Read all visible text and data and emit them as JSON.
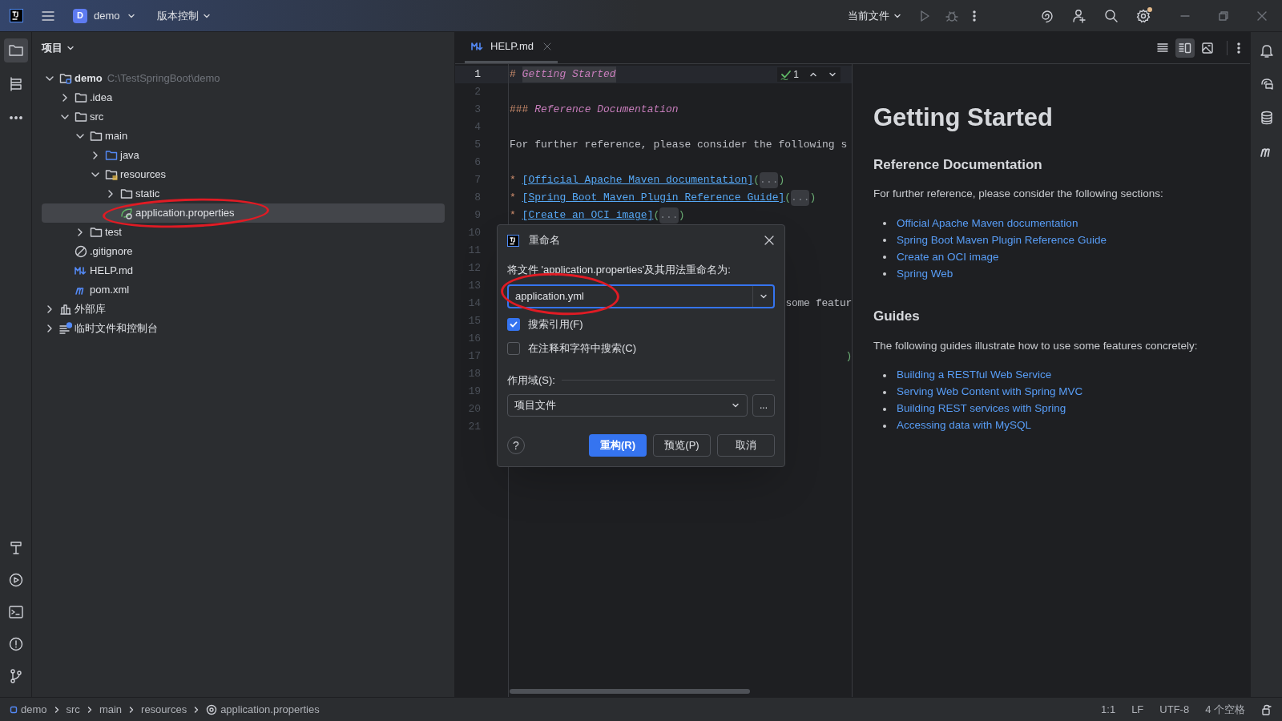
{
  "title_bar": {
    "app_initial": "D",
    "project": "demo",
    "vcs": "版本控制",
    "run_config": "当前文件"
  },
  "tool_windows": [
    {
      "kind": "project",
      "selected": true
    },
    {
      "kind": "structure",
      "selected": false
    },
    {
      "kind": "more",
      "selected": false
    }
  ],
  "project_panel": {
    "title": "项目",
    "tree": [
      {
        "label": "demo",
        "path": "C:\\TestSpringBoot\\demo",
        "kind": "module",
        "expanded": true,
        "selected": false,
        "children": [
          {
            "label": ".idea",
            "kind": "folder",
            "expanded": false,
            "selected": false
          },
          {
            "label": "src",
            "kind": "folder",
            "expanded": true,
            "selected": false,
            "children": [
              {
                "label": "main",
                "kind": "folder",
                "expanded": true,
                "selected": false,
                "children": [
                  {
                    "label": "java",
                    "kind": "source",
                    "expanded": false,
                    "selected": false
                  },
                  {
                    "label": "resources",
                    "kind": "resources",
                    "expanded": true,
                    "selected": false,
                    "children": [
                      {
                        "label": "static",
                        "kind": "folder",
                        "expanded": false,
                        "selected": false
                      },
                      {
                        "label": "application.properties",
                        "kind": "spring",
                        "selected": true,
                        "circled": true
                      }
                    ]
                  }
                ]
              },
              {
                "label": "test",
                "kind": "folder",
                "expanded": false,
                "selected": false
              }
            ]
          },
          {
            "label": ".gitignore",
            "kind": "ignore",
            "selected": false
          },
          {
            "label": "HELP.md",
            "kind": "markdown",
            "selected": false
          },
          {
            "label": "pom.xml",
            "kind": "maven",
            "selected": false
          }
        ]
      },
      {
        "label": "外部库",
        "kind": "library",
        "expanded": false,
        "selected": false
      },
      {
        "label": "临时文件和控制台",
        "kind": "scratch",
        "expanded": false,
        "selected": false
      }
    ]
  },
  "editor": {
    "tabs": [
      {
        "label": "HELP.md",
        "selected": true
      }
    ],
    "inspection_count": "1",
    "view_modes": [
      {
        "kind": "editor",
        "selected": false
      },
      {
        "kind": "split",
        "selected": true
      },
      {
        "kind": "preview",
        "selected": false
      }
    ],
    "lines": [
      {
        "number": "1",
        "current": true,
        "segments": [
          {
            "kind": "mark",
            "text": "# "
          },
          {
            "kind": "heading",
            "text": "Getting Started"
          }
        ]
      },
      {
        "number": "2",
        "current": false
      },
      {
        "number": "3",
        "current": false,
        "segments": [
          {
            "kind": "mark",
            "text": "### "
          },
          {
            "kind": "heading",
            "text": "Reference Documentation"
          }
        ]
      },
      {
        "number": "4",
        "current": false
      },
      {
        "number": "5",
        "current": false,
        "segments": [
          {
            "kind": "plain",
            "text": "For further reference, please consider the following s"
          }
        ]
      },
      {
        "number": "6",
        "current": false
      },
      {
        "number": "7",
        "current": false,
        "segments": [
          {
            "kind": "bullet",
            "text": "* "
          },
          {
            "kind": "link",
            "text": "[Official Apache Maven documentation]"
          },
          {
            "kind": "paren",
            "text": "("
          },
          {
            "kind": "fold",
            "text": "..."
          },
          {
            "kind": "paren",
            "text": ")"
          }
        ]
      },
      {
        "number": "8",
        "current": false,
        "segments": [
          {
            "kind": "bullet",
            "text": "* "
          },
          {
            "kind": "link",
            "text": "[Spring Boot Maven Plugin Reference Guide]"
          },
          {
            "kind": "paren",
            "text": "("
          },
          {
            "kind": "fold",
            "text": "..."
          },
          {
            "kind": "paren",
            "text": ")"
          }
        ]
      },
      {
        "number": "9",
        "current": false,
        "segments": [
          {
            "kind": "bullet",
            "text": "* "
          },
          {
            "kind": "link",
            "text": "[Create an OCI image]"
          },
          {
            "kind": "paren",
            "text": "("
          },
          {
            "kind": "fold",
            "text": "..."
          },
          {
            "kind": "paren",
            "text": ")"
          }
        ]
      },
      {
        "number": "10",
        "current": false
      },
      {
        "number": "11",
        "current": false
      },
      {
        "number": "12",
        "current": false
      },
      {
        "number": "13",
        "current": false
      },
      {
        "number": "14",
        "current": false,
        "partial": true,
        "segments": [
          {
            "kind": "plain",
            "text": "some featur"
          }
        ]
      },
      {
        "number": "15",
        "current": false
      },
      {
        "number": "16",
        "current": false
      },
      {
        "number": "17",
        "current": false,
        "partial": true,
        "segments": [
          {
            "kind": "paren",
            "text": ")"
          }
        ]
      },
      {
        "number": "18",
        "current": false
      },
      {
        "number": "19",
        "current": false
      },
      {
        "number": "20",
        "current": false
      },
      {
        "number": "21",
        "current": false
      }
    ]
  },
  "preview": {
    "title": "Getting Started",
    "sections": [
      {
        "heading": "Reference Documentation",
        "text": "For further reference, please consider the following sections:",
        "links": [
          "Official Apache Maven documentation",
          "Spring Boot Maven Plugin Reference Guide",
          "Create an OCI image",
          "Spring Web"
        ]
      },
      {
        "heading": "Guides",
        "text": "The following guides illustrate how to use some features concretely:",
        "links": [
          "Building a RESTful Web Service",
          "Serving Web Content with Spring MVC",
          "Building REST services with Spring",
          "Accessing data with MySQL"
        ]
      }
    ]
  },
  "rename_dialog": {
    "title": "重命名",
    "prompt": "将文件 'application.properties'及其用法重命名为:",
    "value": "application.yml",
    "circled": true,
    "options": [
      {
        "label": "搜索引用(F)",
        "checked": true
      },
      {
        "label": "在注释和字符中搜索(C)",
        "checked": false
      }
    ],
    "scope_label": "作用域(S):",
    "scope": "项目文件",
    "scope_more": "...",
    "help": "?",
    "buttons": [
      {
        "label": "重构(R)",
        "primary": true
      },
      {
        "label": "预览(P)",
        "primary": false
      },
      {
        "label": "取消",
        "primary": false
      }
    ]
  },
  "status_bar": {
    "breadcrumbs": [
      "demo",
      "src",
      "main",
      "resources",
      "application.properties"
    ],
    "info": [
      "1:1",
      "LF",
      "UTF-8",
      "4 个空格"
    ]
  }
}
